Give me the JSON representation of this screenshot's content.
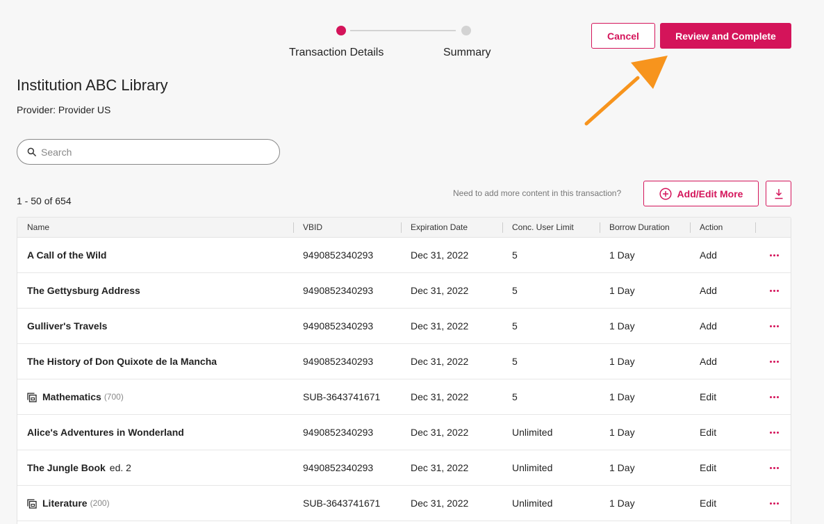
{
  "stepper": {
    "steps": [
      {
        "label": "Transaction Details",
        "state": "active"
      },
      {
        "label": "Summary",
        "state": "inactive"
      }
    ]
  },
  "header": {
    "cancel_label": "Cancel",
    "review_label": "Review and Complete"
  },
  "page": {
    "title": "Institution ABC Library",
    "provider": "Provider: Provider US"
  },
  "search": {
    "placeholder": "Search",
    "value": ""
  },
  "toolbar": {
    "count": "1 - 50 of 654",
    "hint": "Need to add more content in this transaction?",
    "add_label": "Add/Edit More"
  },
  "table": {
    "columns": [
      "Name",
      "VBID",
      "Expiration Date",
      "Conc. User Limit",
      "Borrow Duration",
      "Action"
    ],
    "rows": [
      {
        "name": "A Call of the Wild",
        "sub": "",
        "collection": false,
        "vbid": "9490852340293",
        "expiration": "Dec 31, 2022",
        "conc": "5",
        "borrow": "1 Day",
        "action": "Add"
      },
      {
        "name": "The Gettysburg Address",
        "sub": "",
        "collection": false,
        "vbid": "9490852340293",
        "expiration": "Dec 31, 2022",
        "conc": "5",
        "borrow": "1 Day",
        "action": "Add"
      },
      {
        "name": "Gulliver's Travels",
        "sub": "",
        "collection": false,
        "vbid": "9490852340293",
        "expiration": "Dec 31, 2022",
        "conc": "5",
        "borrow": "1 Day",
        "action": "Add"
      },
      {
        "name": "The History of Don Quixote de la Mancha",
        "sub": "",
        "collection": false,
        "vbid": "9490852340293",
        "expiration": "Dec 31, 2022",
        "conc": "5",
        "borrow": "1 Day",
        "action": "Add"
      },
      {
        "name": "Mathematics",
        "sub": "(700)",
        "collection": true,
        "vbid": "SUB-3643741671",
        "expiration": "Dec 31, 2022",
        "conc": "5",
        "borrow": "1 Day",
        "action": "Edit"
      },
      {
        "name": "Alice's Adventures in Wonderland",
        "sub": "",
        "collection": false,
        "vbid": "9490852340293",
        "expiration": "Dec 31, 2022",
        "conc": "Unlimited",
        "borrow": "1 Day",
        "action": "Edit"
      },
      {
        "name": "The Jungle Book",
        "edition": "ed. 2",
        "collection": false,
        "vbid": "9490852340293",
        "expiration": "Dec 31, 2022",
        "conc": "Unlimited",
        "borrow": "1 Day",
        "action": "Edit"
      },
      {
        "name": "Literature",
        "sub": "(200)",
        "collection": true,
        "vbid": "SUB-3643741671",
        "expiration": "Dec 31, 2022",
        "conc": "Unlimited",
        "borrow": "1 Day",
        "action": "Edit"
      }
    ]
  },
  "colors": {
    "accent": "#d4145a",
    "annotation_arrow": "#f7941d"
  },
  "icons": {
    "search": "search-icon",
    "add": "plus-circle-icon",
    "download": "download-icon",
    "more": "more-horizontal-icon",
    "collection": "collection-icon"
  }
}
